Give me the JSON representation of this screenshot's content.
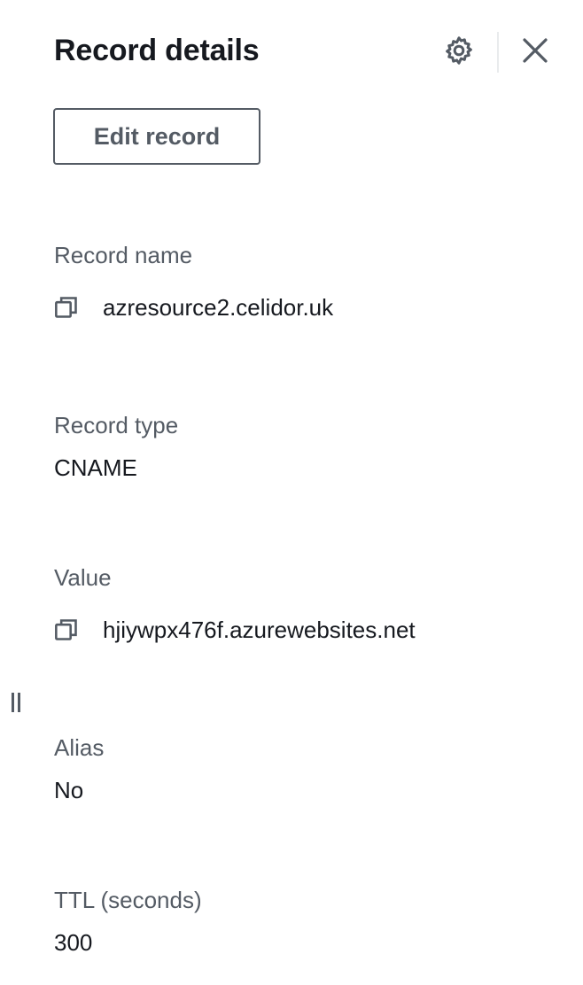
{
  "panel": {
    "title": "Record details",
    "settings_icon": "gear-icon",
    "close_icon": "close-icon",
    "edit_button_label": "Edit record"
  },
  "fields": {
    "record_name": {
      "label": "Record name",
      "value": "azresource2.celidor.uk",
      "icon": "copy-icon"
    },
    "record_type": {
      "label": "Record type",
      "value": "CNAME"
    },
    "value": {
      "label": "Value",
      "value": "hjiywpx476f.azurewebsites.net",
      "icon": "copy-icon"
    },
    "alias": {
      "label": "Alias",
      "value": "No"
    },
    "ttl": {
      "label": "TTL (seconds)",
      "value": "300"
    }
  },
  "resize_handle_icon": "drag-handle-icon",
  "colors": {
    "text": "#16191f",
    "label": "#545b64",
    "icon": "#545b64",
    "divider": "#e9ebed",
    "background": "#ffffff"
  }
}
